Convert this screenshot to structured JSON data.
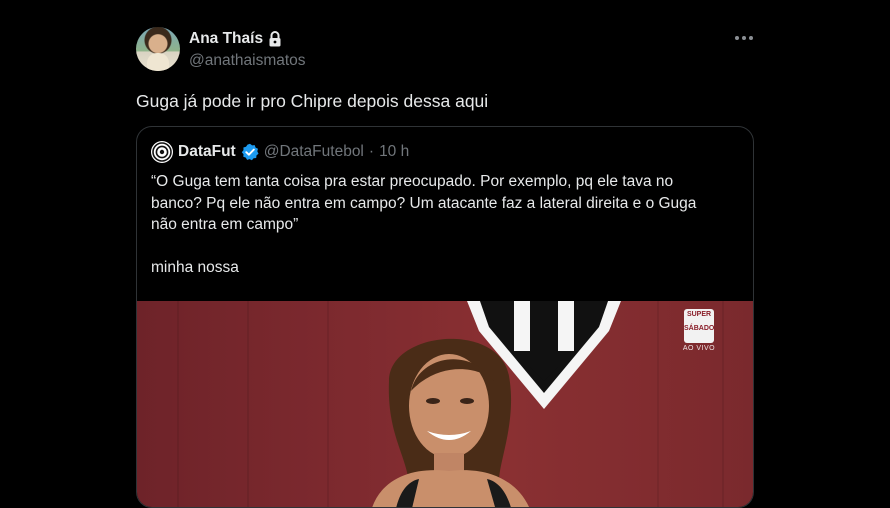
{
  "author": {
    "name": "Ana Thaís",
    "handle": "@anathaismatos",
    "protected": true
  },
  "tweet": {
    "text": "Guga já pode ir pro Chipre depois dessa aqui"
  },
  "quoted": {
    "name": "DataFut",
    "handle": "@DataFutebol",
    "separator": "·",
    "time": "10 h",
    "verified": true,
    "lines": [
      "“O Guga tem tanta coisa pra estar preocupado. Por exemplo, pq ele tava no",
      "banco? Pq ele não entra em campo? Um atacante faz a lateral direita e o Guga",
      "não entra em campo”"
    ],
    "footer": "minha nossa",
    "media": {
      "badge_top": "SUPER",
      "badge_mid": "SÁBADO",
      "badge_live": "AO VIVO"
    }
  },
  "colors": {
    "background": "#000000",
    "text": "#e7e9ea",
    "muted": "#71767b",
    "border": "#2f3336",
    "verified": "#1d9bf0"
  },
  "icons": [
    "lock-icon",
    "more-icon",
    "datafut-logo-icon",
    "verified-icon"
  ]
}
